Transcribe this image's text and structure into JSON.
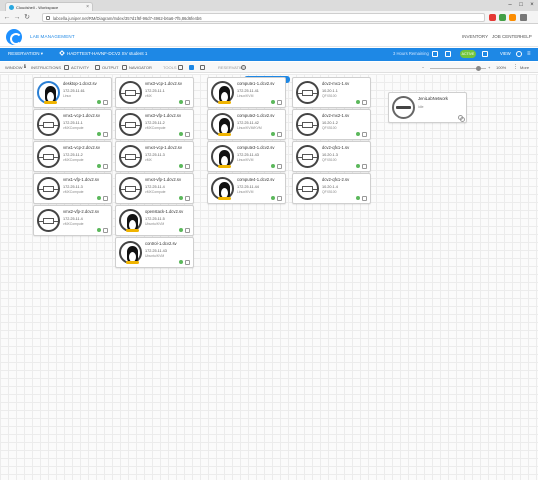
{
  "browser": {
    "tab_title": "Cloudshell - Workspace",
    "url": "labcella.juniper.net/RM/Diagram/Index/35?d1f6f-96d7-4962-b6a6-7f5,86d6fe4b6",
    "window_buttons": [
      "–",
      "□",
      "×"
    ]
  },
  "app": {
    "section": "LAB MANAGEMENT",
    "header_links": [
      "INVENTORY",
      "JOB CENTER",
      "HELP"
    ],
    "reservation_label": "RESERVATION",
    "lab_title": "HADTTEST-HAVNF-DCV2 SV student 1",
    "time_left": "3 Hours Remaining",
    "status": "ACTIVE",
    "view_label": "VIEW"
  },
  "toolbar": {
    "view_lbl": "WINDOW",
    "instructions": "INSTRUCTIONS",
    "activity": "ACTIVITY",
    "output": "OUTPUT",
    "navigator": "NAVIGATOR",
    "tools": "TOOLS",
    "reservation": "RESERVATION",
    "zoom": "100%",
    "more": "More"
  },
  "reservation_badge": "RESERVATION",
  "devices": {
    "col1": [
      {
        "name": "desktop-1.dcv2.sv",
        "ip": "172.25.11.61",
        "sub": "Linux",
        "icon": "desktop"
      },
      {
        "name": "vmx1-vcp-1.dcv2.sv",
        "ip": "172.25.11.1",
        "sub": "vMXCompute",
        "icon": "switch"
      },
      {
        "name": "vmx1-vcp-2.dcv2.sv",
        "ip": "172.25.11.2",
        "sub": "vMXCompute",
        "icon": "switch"
      },
      {
        "name": "vmx1-vfp-1.dcv2.sv",
        "ip": "172.25.11.3",
        "sub": "vMXCompute",
        "icon": "switch"
      },
      {
        "name": "vmx2-vfp-2.dcv2.sv",
        "ip": "172.25.11.4",
        "sub": "vMXCompute",
        "icon": "switch"
      }
    ],
    "col2": [
      {
        "name": "vmx3-vcp-1.dcv2.sv",
        "ip": "172.25.11.1",
        "sub": "vMX",
        "icon": "switch"
      },
      {
        "name": "vmx3-vfp-1.dcv2.sv",
        "ip": "172.25.11.2",
        "sub": "vMXCompute",
        "icon": "switch"
      },
      {
        "name": "vmx4-vcp-1.dcv2.sv",
        "ip": "172.25.11.3",
        "sub": "vMX",
        "icon": "switch"
      },
      {
        "name": "vmx4-vfp-1.dcv2.sv",
        "ip": "172.25.11.4",
        "sub": "vMXCompute",
        "icon": "switch"
      },
      {
        "name": "openstack-1.dcv2.sv",
        "ip": "172.25.11.5",
        "sub": "Ubuntu/KVM",
        "icon": "linux"
      },
      {
        "name": "control-1.dcv2.sv",
        "ip": "172.25.11.43",
        "sub": "Ubuntu/KVM",
        "icon": "linux"
      }
    ],
    "col3": [
      {
        "name": "compute1-1.dcv2.sv",
        "ip": "172.25.11.41",
        "sub": "Linux/KVM",
        "icon": "linux"
      },
      {
        "name": "compute2-1.dcv2.sv",
        "ip": "172.25.11.42",
        "sub": "Linux/KVM/KVM",
        "icon": "linux"
      },
      {
        "name": "compute3-1.dcv2.sv",
        "ip": "172.25.11.43",
        "sub": "Linux/KVM",
        "icon": "linux"
      },
      {
        "name": "compute4-1.dcv2.sv",
        "ip": "172.25.11.44",
        "sub": "Linux/KVM",
        "icon": "linux"
      }
    ],
    "col4": [
      {
        "name": "dcv2-mx1-1.sv",
        "ip": "10.20.1.1",
        "sub": "QFX5100",
        "icon": "switch"
      },
      {
        "name": "dcv2-mx2-1.sv",
        "ip": "10.20.1.2",
        "sub": "QFX5100",
        "icon": "switch"
      },
      {
        "name": "dcv2-qfx1-1.sv",
        "ip": "10.20.1.3",
        "sub": "QFX5100",
        "icon": "switch"
      },
      {
        "name": "dcv2-qfx1-2.sv",
        "ip": "10.20.1.4",
        "sub": "QFX5100",
        "icon": "switch"
      }
    ],
    "col5": [
      {
        "name": "JeniLabNetwork",
        "ip": "",
        "sub": "Idle",
        "icon": "network"
      }
    ]
  }
}
